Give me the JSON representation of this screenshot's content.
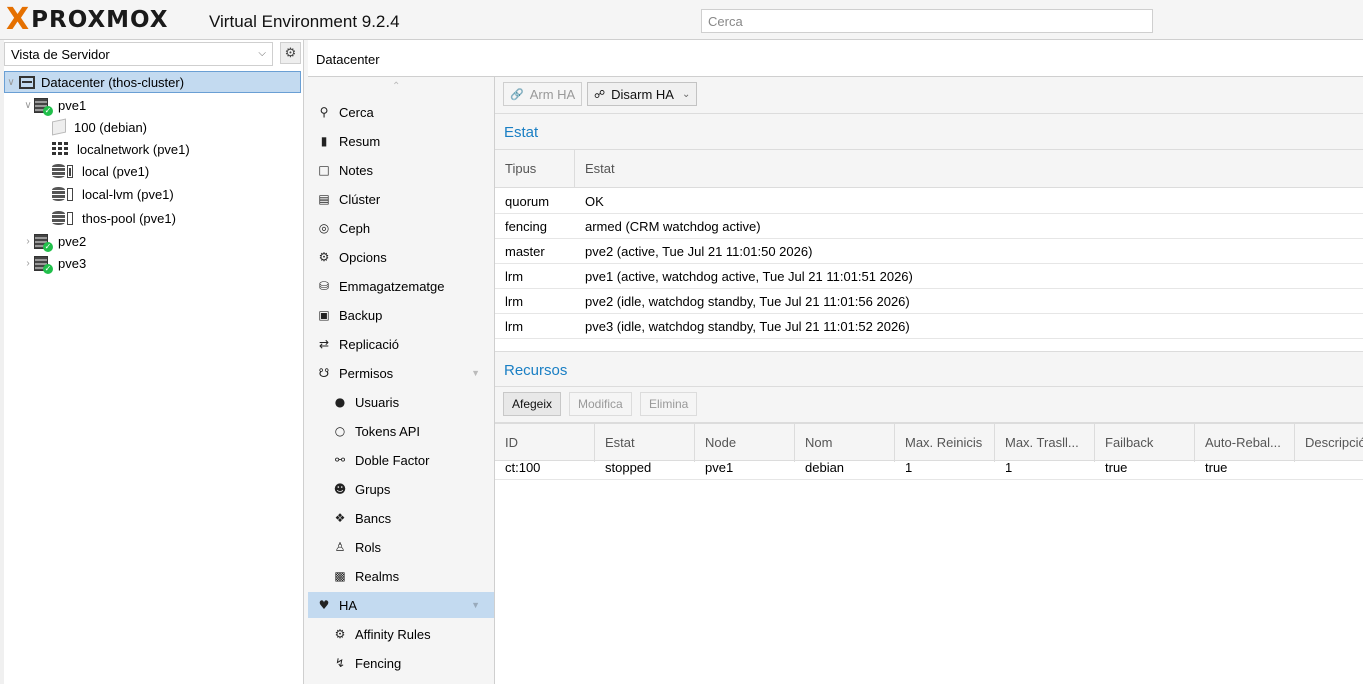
{
  "header": {
    "logo_text": "PROXMOX",
    "version": "Virtual Environment 9.2.4",
    "search_placeholder": "Cerca"
  },
  "left_panel": {
    "view_select": "Vista de Servidor",
    "tree": [
      {
        "label": "Datacenter (thos-cluster)",
        "icon": "datacenter-icon",
        "selected": true
      },
      {
        "label": "pve1",
        "icon": "node-online-icon",
        "expanded": true
      },
      {
        "label": "100 (debian)",
        "icon": "container-icon"
      },
      {
        "label": "localnetwork (pve1)",
        "icon": "network-icon"
      },
      {
        "label": "local (pve1)",
        "icon": "storage-icon"
      },
      {
        "label": "local-lvm (pve1)",
        "icon": "storage-icon"
      },
      {
        "label": "thos-pool (pve1)",
        "icon": "storage-icon"
      },
      {
        "label": "pve2",
        "icon": "node-online-icon",
        "expanded": false
      },
      {
        "label": "pve3",
        "icon": "node-online-icon",
        "expanded": false
      }
    ]
  },
  "breadcrumb": "Datacenter",
  "menu": [
    {
      "label": "Cerca",
      "icon": "search-icon"
    },
    {
      "label": "Resum",
      "icon": "book-icon"
    },
    {
      "label": "Notes",
      "icon": "note-icon"
    },
    {
      "label": "Clúster",
      "icon": "server-icon"
    },
    {
      "label": "Ceph",
      "icon": "ceph-icon"
    },
    {
      "label": "Opcions",
      "icon": "gear-icon"
    },
    {
      "label": "Emmagatzematge",
      "icon": "database-icon"
    },
    {
      "label": "Backup",
      "icon": "floppy-icon"
    },
    {
      "label": "Replicació",
      "icon": "retweet-icon"
    },
    {
      "label": "Permisos",
      "icon": "unlock-icon"
    },
    {
      "label": "Usuaris",
      "icon": "user-icon"
    },
    {
      "label": "Tokens API",
      "icon": "user-outline-icon"
    },
    {
      "label": "Doble Factor",
      "icon": "key-icon"
    },
    {
      "label": "Grups",
      "icon": "users-icon"
    },
    {
      "label": "Bancs",
      "icon": "tags-icon"
    },
    {
      "label": "Rols",
      "icon": "male-icon"
    },
    {
      "label": "Realms",
      "icon": "address-book-icon"
    },
    {
      "label": "HA",
      "icon": "heartbeat-icon"
    },
    {
      "label": "Affinity Rules",
      "icon": "cogs-icon"
    },
    {
      "label": "Fencing",
      "icon": "bolt-icon"
    }
  ],
  "toolbar": {
    "arm": "Arm HA",
    "disarm": "Disarm HA"
  },
  "status": {
    "title": "Estat",
    "columns": [
      "Tipus",
      "Estat"
    ],
    "rows": [
      [
        "quorum",
        "OK"
      ],
      [
        "fencing",
        "armed (CRM watchdog active)"
      ],
      [
        "master",
        "pve2 (active, Tue Jul 21 11:01:50 2026)"
      ],
      [
        "lrm",
        "pve1 (active, watchdog active, Tue Jul 21 11:01:51 2026)"
      ],
      [
        "lrm",
        "pve2 (idle, watchdog standby, Tue Jul 21 11:01:56 2026)"
      ],
      [
        "lrm",
        "pve3 (idle, watchdog standby, Tue Jul 21 11:01:52 2026)"
      ]
    ]
  },
  "resources": {
    "title": "Recursos",
    "buttons": {
      "add": "Afegeix",
      "edit": "Modifica",
      "remove": "Elimina"
    },
    "columns": [
      "ID",
      "Estat",
      "Node",
      "Nom",
      "Max. Reinicis",
      "Max. Trasll...",
      "Failback",
      "Auto-Rebal...",
      "Descripció"
    ],
    "rows": [
      [
        "ct:100",
        "stopped",
        "pve1",
        "debian",
        "1",
        "1",
        "true",
        "true",
        ""
      ]
    ]
  },
  "colors": {
    "accent": "#e57000",
    "selection": "#c3daf0",
    "link": "#1a7fc4",
    "online": "#21bf4b"
  }
}
